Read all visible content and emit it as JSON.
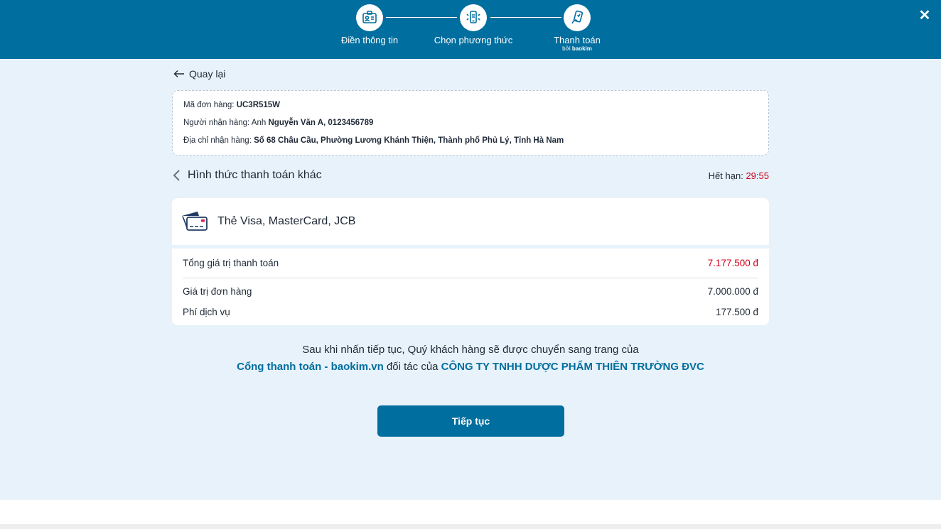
{
  "header": {
    "steps": [
      {
        "label": "Điền thông tin",
        "icon": "id-card-icon"
      },
      {
        "label": "Chọn phương thức",
        "icon": "phone-select-icon"
      },
      {
        "label": "Thanh toán",
        "icon": "mobile-payment-icon",
        "sub_prefix": "bởi",
        "sub_brand": "baokim"
      }
    ],
    "close_icon": "close-icon",
    "background_color": "#006e9e"
  },
  "back": {
    "label": "Quay lại",
    "icon": "arrow-left-icon"
  },
  "order": {
    "code_label": "Mã đơn hàng:",
    "code_value": "UC3R515W",
    "recipient_label": "Người nhận hàng: Anh",
    "recipient_value": "Nguyễn Văn A, 0123456789",
    "address_label": "Địa chỉ nhận hàng:",
    "address_value": "Số 68 Châu Cầu, Phường Lương Khánh Thiện, Thành phố Phủ Lý, Tỉnh Hà Nam"
  },
  "method": {
    "back_label": "Hình thức thanh toán khác",
    "expiry_label": "Hết hạn:",
    "expiry_value": "29:55",
    "card_label": "Thẻ Visa, MasterCard, JCB",
    "card_icon": "credit-card-icon"
  },
  "totals": {
    "total_label": "Tổng giá trị thanh toán",
    "total_value": "7.177.500 đ",
    "order_label": "Giá trị đơn hàng",
    "order_value": "7.000.000 đ",
    "fee_label": "Phí dịch vụ",
    "fee_value": "177.500 đ"
  },
  "notice": {
    "line1": "Sau khi nhấn tiếp tục, Quý khách hàng sẽ được chuyển sang trang của",
    "gateway": "Cổng thanh toán - baokim.vn",
    "partner_text": "đối tác của",
    "company": "CÔNG TY TNHH DƯỢC PHẨM THIÊN TRƯỜNG ĐVC"
  },
  "continue_label": "Tiếp tục",
  "colors": {
    "accent": "#006e9e",
    "highlight": "#d0021b",
    "page_bg": "#e8f2fa"
  }
}
